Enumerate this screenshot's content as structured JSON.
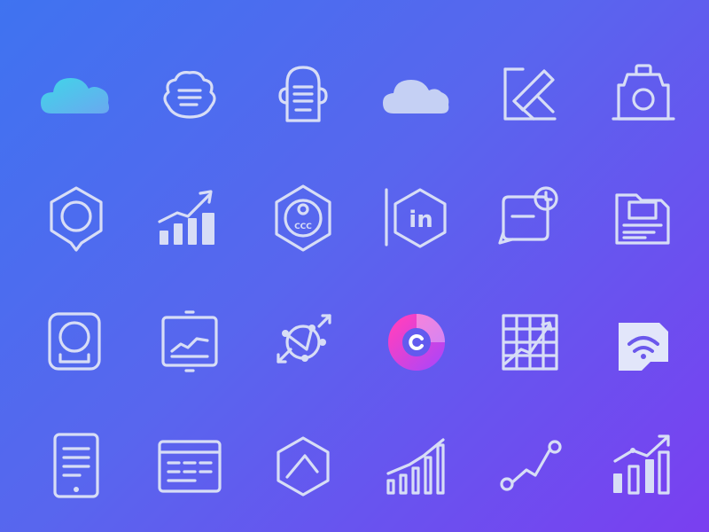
{
  "colors": {
    "background_start": "#3f73f0",
    "background_end": "#7a3ff0",
    "icon_stroke": "#d7ddf6",
    "cloud_gradient_start": "#3fd6e8",
    "cloud_gradient_end": "#6aa8f0",
    "ring_gradient_start": "#ff3fbf",
    "ring_gradient_end": "#b245f5"
  },
  "icons": [
    "cloud-gradient-icon",
    "food-bowl-icon",
    "document-scroll-icon",
    "cloud-icon",
    "edit-crop-icon",
    "camera-box-icon",
    "hexagon-pin-icon",
    "growth-chart-icon",
    "hexagon-clock-badge-icon",
    "linkedin-hexagon-icon",
    "screen-clock-icon",
    "folder-document-icon",
    "rounded-frame-icon",
    "monitor-chart-icon",
    "network-nodes-icon",
    "donut-ring-icon",
    "grid-chart-icon",
    "wifi-box-icon",
    "tablet-document-icon",
    "browser-layout-icon",
    "hexagon-box-icon",
    "bar-chart-icon",
    "line-graph-icon",
    "trend-bars-icon"
  ],
  "labels": {
    "in_text": "in",
    "badge_text": "CCC"
  }
}
